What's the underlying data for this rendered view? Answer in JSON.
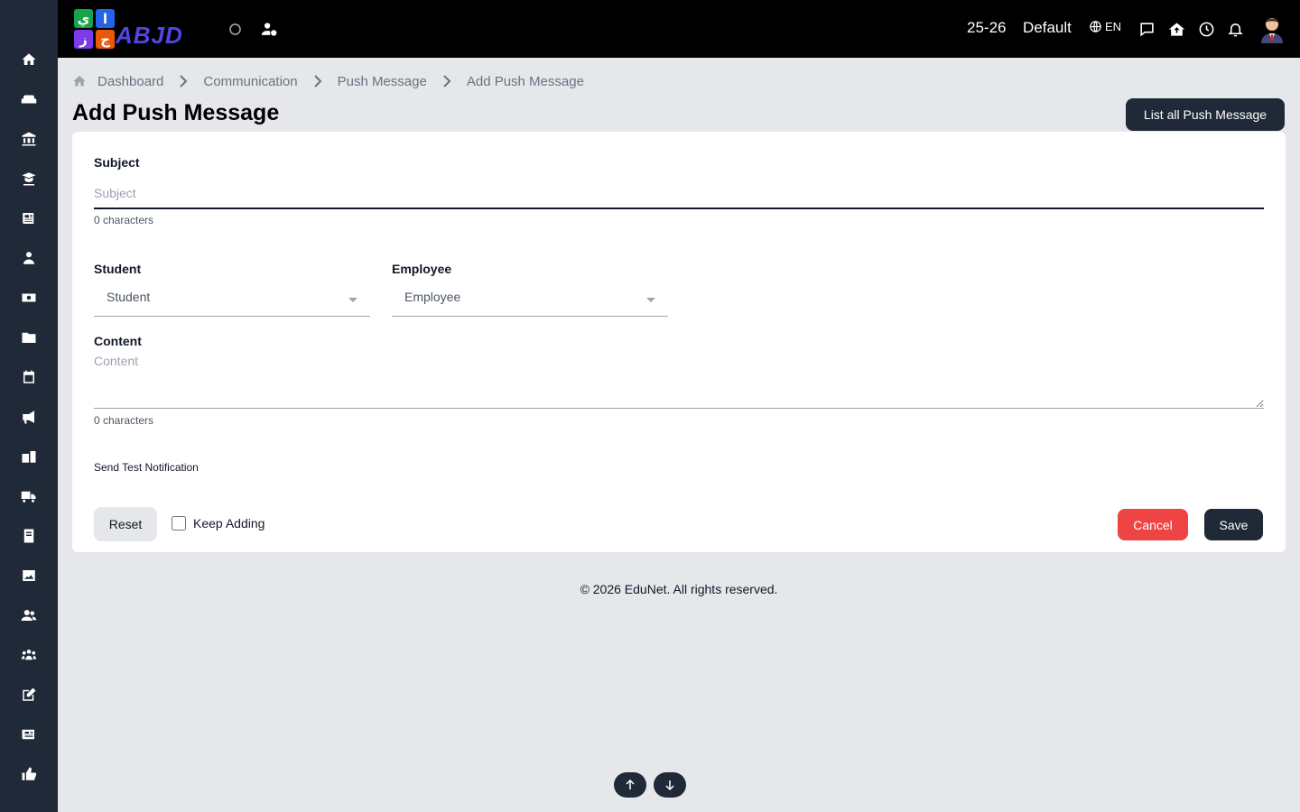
{
  "colors": {
    "sidebar": "#1f2937",
    "topbar": "#000000",
    "primary": "#1f2937",
    "danger": "#ef4444",
    "page_bg": "#e5e7eb"
  },
  "sidebar": {
    "items": [
      {
        "icon": "home-icon"
      },
      {
        "icon": "couch-icon"
      },
      {
        "icon": "bank-icon"
      },
      {
        "icon": "graduate-icon"
      },
      {
        "icon": "newspaper-icon"
      },
      {
        "icon": "teacher-icon"
      },
      {
        "icon": "money-icon"
      },
      {
        "icon": "folder-icon"
      },
      {
        "icon": "calendar-icon"
      },
      {
        "icon": "megaphone-icon"
      },
      {
        "icon": "school-icon"
      },
      {
        "icon": "truck-icon"
      },
      {
        "icon": "book-icon"
      },
      {
        "icon": "image-icon"
      },
      {
        "icon": "users-icon"
      },
      {
        "icon": "group-icon"
      },
      {
        "icon": "edit-icon"
      },
      {
        "icon": "news-icon"
      },
      {
        "icon": "thumbs-up-icon"
      }
    ]
  },
  "topbar": {
    "logo": {
      "tile_1": "ي",
      "tile_2": "ا",
      "tile_3": "ز",
      "tile_4": "ج",
      "text": "ABJD"
    },
    "session": "25-26",
    "profile": "Default",
    "language": "EN"
  },
  "breadcrumb": {
    "items": [
      "Dashboard",
      "Communication",
      "Push Message",
      "Add Push Message"
    ]
  },
  "page": {
    "title": "Add Push Message",
    "list_button": "List all Push Message"
  },
  "form": {
    "subject": {
      "label": "Subject",
      "placeholder": "Subject",
      "counter": "0 characters"
    },
    "student": {
      "label": "Student",
      "value": "Student"
    },
    "employee": {
      "label": "Employee",
      "value": "Employee"
    },
    "content": {
      "label": "Content",
      "placeholder": "Content",
      "counter": "0 characters"
    },
    "send_test": "Send Test Notification",
    "reset": "Reset",
    "keep_adding": "Keep Adding",
    "cancel": "Cancel",
    "save": "Save"
  },
  "footer": {
    "text": "© 2026 EduNet. All rights reserved."
  }
}
